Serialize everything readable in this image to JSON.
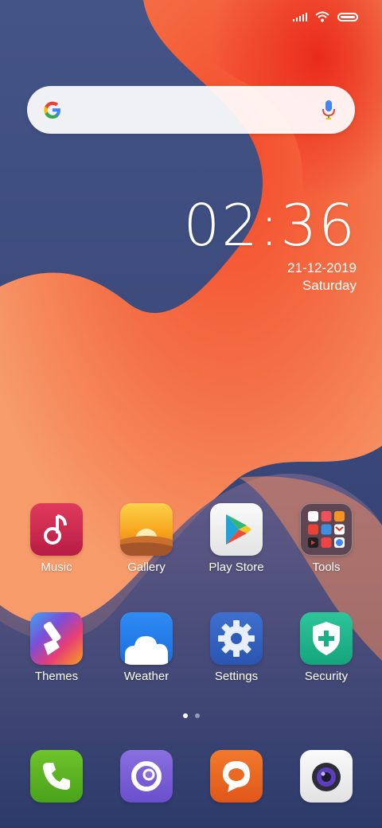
{
  "status_bar": {
    "icons": [
      "signal-icon",
      "wifi-icon",
      "battery-icon"
    ]
  },
  "search": {
    "logo": "google-g-icon",
    "mic": "mic-icon"
  },
  "clock": {
    "time": "02:36",
    "date": "21-12-2019",
    "day": "Saturday"
  },
  "apps_row1": [
    {
      "label": "Music",
      "icon": "music-icon"
    },
    {
      "label": "Gallery",
      "icon": "gallery-icon"
    },
    {
      "label": "Play Store",
      "icon": "play-store-icon"
    },
    {
      "label": "Tools",
      "icon": "tools-folder-icon"
    }
  ],
  "apps_row2": [
    {
      "label": "Themes",
      "icon": "themes-icon"
    },
    {
      "label": "Weather",
      "icon": "weather-icon"
    },
    {
      "label": "Settings",
      "icon": "settings-icon"
    },
    {
      "label": "Security",
      "icon": "security-icon"
    }
  ],
  "page_indicator": {
    "pages": 2,
    "active": 1
  },
  "dock": [
    {
      "icon": "phone-icon"
    },
    {
      "icon": "browser-icon"
    },
    {
      "icon": "messaging-icon"
    },
    {
      "icon": "camera-icon"
    }
  ]
}
